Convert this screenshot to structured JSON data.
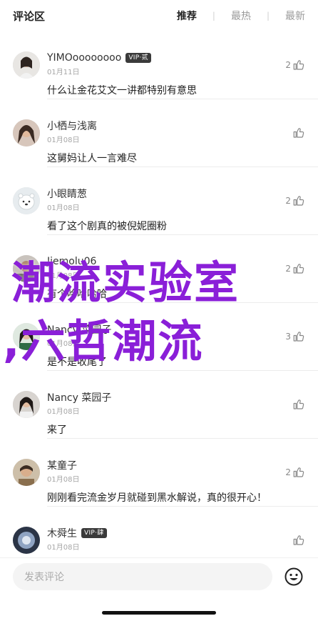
{
  "header": {
    "title": "评论区",
    "tabs": [
      {
        "label": "推荐",
        "active": true
      },
      {
        "label": "最热",
        "active": false
      },
      {
        "label": "最新",
        "active": false
      }
    ]
  },
  "comments": [
    {
      "name": "YIMOoooooooo",
      "vip": "VIP·贰",
      "date": "01月11日",
      "text": "什么让金花艾文一讲都特别有意思",
      "likes": "2"
    },
    {
      "name": "小栖与浅离",
      "vip": "",
      "date": "01月08日",
      "text": "这舅妈让人一言难尽",
      "likes": ""
    },
    {
      "name": "小眼睛葱",
      "vip": "",
      "date": "01月08日",
      "text": "看了这个剧真的被倪妮圈粉",
      "likes": "2"
    },
    {
      "name": "Jiemolu06",
      "vip": "",
      "date": "01月08日",
      "text": "有个哈哈哈哈",
      "likes": "2"
    },
    {
      "name": "Nancy 菜园子",
      "vip": "",
      "date": "01月08日",
      "text": "是不是收尾了",
      "likes": "3"
    },
    {
      "name": "Nancy 菜园子",
      "vip": "",
      "date": "01月08日",
      "text": "来了",
      "likes": ""
    },
    {
      "name": "某童子",
      "vip": "",
      "date": "01月08日",
      "text": "刚刚看完流金岁月就碰到黑水解说，真的很开心！",
      "likes": "2"
    },
    {
      "name": "木舜生",
      "vip": "VIP·肆",
      "date": "01月08日",
      "text": "",
      "likes": ""
    }
  ],
  "watermark": {
    "line1": "潮流实验室",
    "line2": ",六哲潮流"
  },
  "composer": {
    "placeholder": "发表评论"
  },
  "icons": {
    "like": "thumb-up-icon",
    "emoji": "smiley-face-icon"
  },
  "colors": {
    "watermark": "#8a1fd8",
    "vip_badge": "#3a3a3a"
  }
}
